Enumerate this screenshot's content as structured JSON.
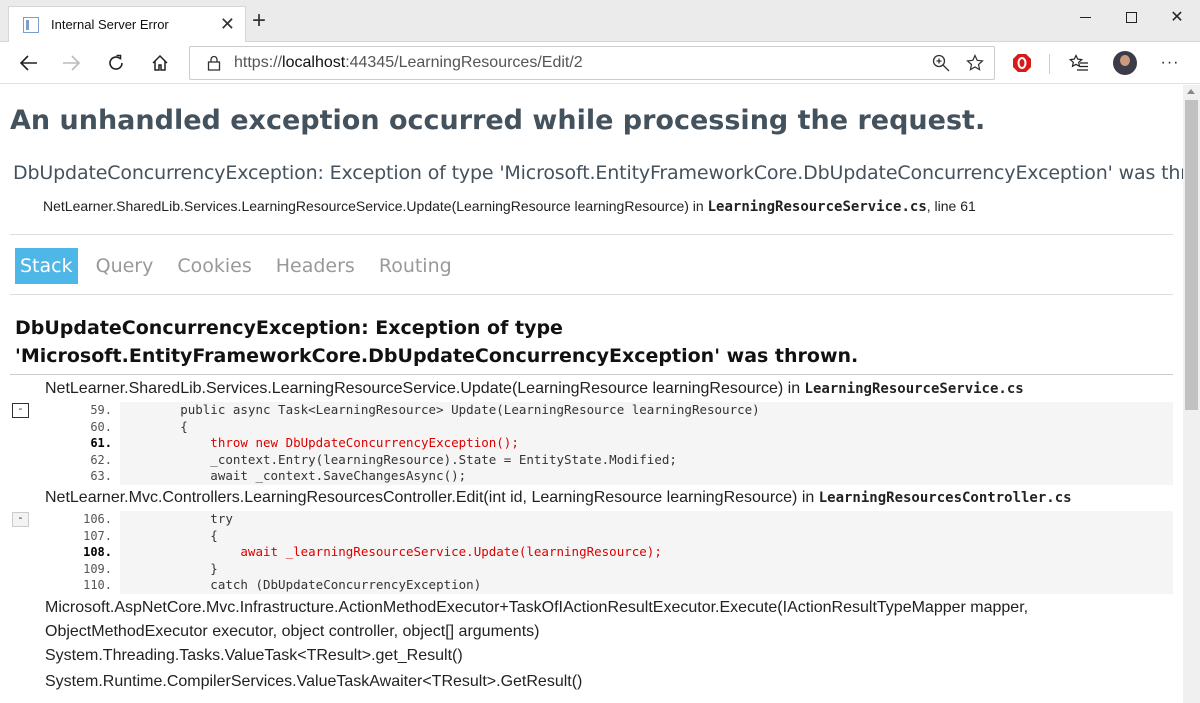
{
  "browser": {
    "tab_title": "Internal Server Error",
    "url_scheme": "https://",
    "url_host": "localhost",
    "url_rest": ":44345/LearningResources/Edit/2"
  },
  "page": {
    "title": "An unhandled exception occurred while processing the request.",
    "message": "DbUpdateConcurrencyException: Exception of type 'Microsoft.EntityFrameworkCore.DbUpdateConcurrencyException' was thrown.",
    "location_prefix": "NetLearner.SharedLib.Services.LearningResourceService.Update(LearningResource learningResource) in ",
    "location_file": "LearningResourceService.cs",
    "location_suffix": ", line 61",
    "tabs": [
      "Stack",
      "Query",
      "Cookies",
      "Headers",
      "Routing"
    ],
    "stack_title": "DbUpdateConcurrencyException: Exception of type 'Microsoft.EntityFrameworkCore.DbUpdateConcurrencyException' was thrown.",
    "frames": [
      {
        "method": "NetLearner.SharedLib.Services.LearningResourceService.Update(LearningResource learningResource) in ",
        "file": "LearningResourceService.cs",
        "toggle": "-",
        "line_numbers": [
          "59.",
          "60.",
          "61.",
          "62.",
          "63."
        ],
        "code": [
          "        public async Task<LearningResource> Update(LearningResource learningResource)",
          "        {",
          "            throw new DbUpdateConcurrencyException();",
          "            _context.Entry(learningResource).State = EntityState.Modified;",
          "            await _context.SaveChangesAsync();"
        ]
      },
      {
        "method": "NetLearner.Mvc.Controllers.LearningResourcesController.Edit(int id, LearningResource learningResource) in ",
        "file": "LearningResourcesController.cs",
        "toggle": "-",
        "line_numbers": [
          "106.",
          "107.",
          "108.",
          "109.",
          "110."
        ],
        "code": [
          "            try",
          "            {",
          "                await _learningResourceService.Update(learningResource);",
          "            }",
          "            catch (DbUpdateConcurrencyException)"
        ]
      }
    ],
    "plain_frames": [
      "Microsoft.AspNetCore.Mvc.Infrastructure.ActionMethodExecutor+TaskOfIActionResultExecutor.Execute(IActionResultTypeMapper mapper, ObjectMethodExecutor executor, object controller, object[] arguments)",
      "System.Threading.Tasks.ValueTask<TResult>.get_Result()",
      "System.Runtime.CompilerServices.ValueTaskAwaiter<TResult>.GetResult()"
    ]
  },
  "colors": {
    "active_tab": "#4fb6e8",
    "error_code": "#dd0000",
    "heading": "#44525e"
  }
}
